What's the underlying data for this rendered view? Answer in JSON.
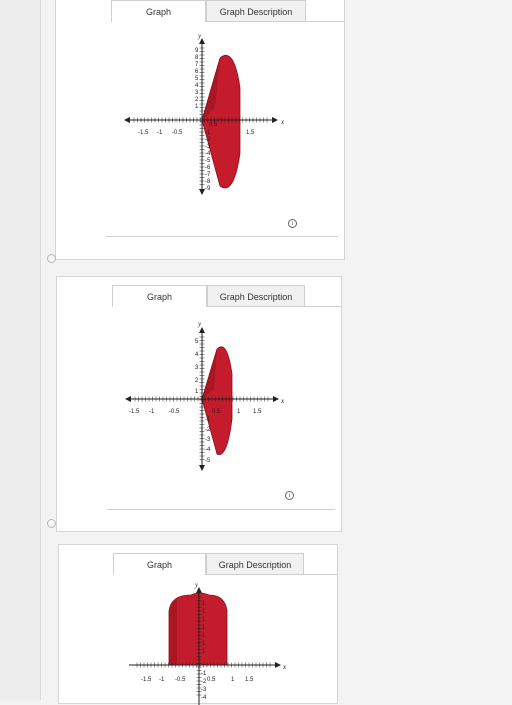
{
  "tabs": {
    "graph": "Graph",
    "description": "Graph Description"
  },
  "info_glyph": "i",
  "options": [
    {
      "x_ticks": [
        "-1.5",
        "-1",
        "-0.5",
        "0.5",
        "1.5"
      ],
      "y_ticks_pos": [
        "9",
        "8",
        "7",
        "6",
        "5",
        "4",
        "3",
        "2",
        "1"
      ],
      "y_ticks_neg": [
        "-1",
        "-2",
        "-3",
        "-4",
        "-5",
        "-6",
        "-7",
        "-8",
        "-9"
      ],
      "x_name": "x",
      "y_name": "y"
    },
    {
      "x_ticks": [
        "-1.5",
        "-1",
        "-0.5",
        "0.5",
        "1",
        "1.5"
      ],
      "y_ticks_pos": [
        "5",
        "4",
        "3",
        "2",
        "1"
      ],
      "y_ticks_neg": [
        "-1",
        "-2",
        "-3",
        "-4",
        "-5"
      ],
      "x_name": "x",
      "y_name": "y"
    },
    {
      "x_ticks": [
        "-1.5",
        "-1",
        "-0.5",
        "0.5",
        "1",
        "1.5"
      ],
      "y_ticks_pos": [
        "1",
        "1",
        "1",
        "1",
        "1",
        "1",
        "1"
      ],
      "y_ticks_neg": [
        "-1",
        "-2",
        "-3",
        "-4"
      ],
      "x_name": "x",
      "y_name": "y"
    }
  ],
  "colors": {
    "fill": "#c41c2c",
    "fill_dark": "#8e0f1c",
    "axis": "#222222"
  }
}
